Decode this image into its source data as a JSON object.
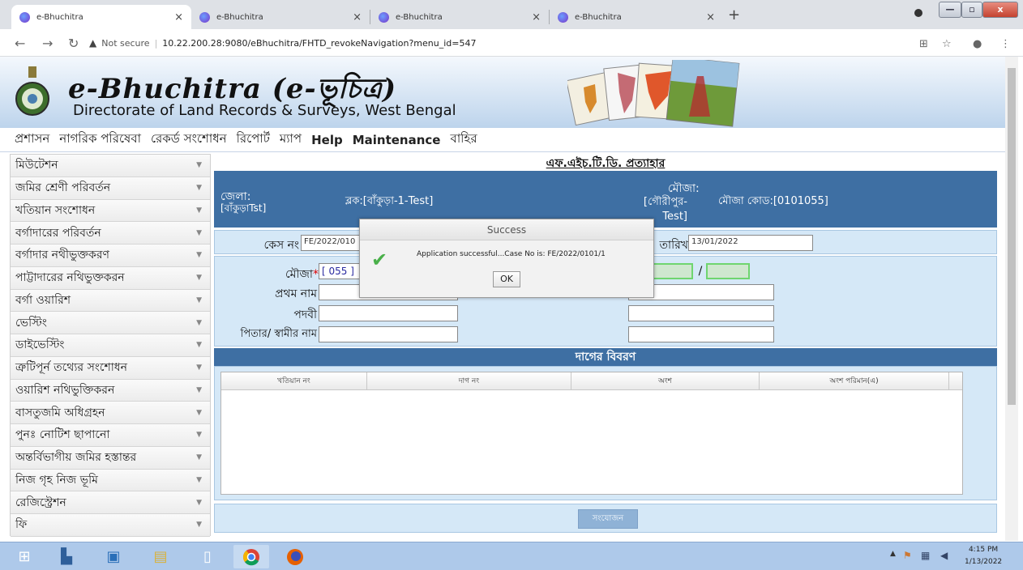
{
  "browser": {
    "tabs": [
      {
        "title": "e-Bhuchitra"
      },
      {
        "title": "e-Bhuchitra"
      },
      {
        "title": "e-Bhuchitra"
      },
      {
        "title": "e-Bhuchitra"
      }
    ],
    "security_label": "Not secure",
    "url": "10.22.200.28:9080/eBhuchitra/FHTD_revokeNavigation?menu_id=547"
  },
  "site": {
    "title": "e-Bhuchitra (e-ভূচিত্র)",
    "subtitle": "Directorate of Land Records & Surveys, West Bengal"
  },
  "menu": [
    "প্রশাসন",
    "নাগরিক পরিষেবা",
    "রেকর্ড সংশোধন",
    "রিপোর্ট",
    "ম্যাপ",
    "Help",
    "Maintenance",
    "বাহির"
  ],
  "sidebar": [
    "মিউটেশন",
    "জমির শ্রেণী পরিবর্তন",
    "খতিয়ান সংশোধন",
    "বর্গাদারের পরিবর্তন",
    "বর্গাদার নথীভুক্তকরণ",
    "পাট্টাদারের নথিভুক্তকরন",
    "বর্গা ওয়ারিশ",
    "ভেস্টিং",
    "ডাইভেস্টিং",
    "ত্রুটিপূর্ন তথ্যের সংশোধন",
    "ওয়ারিশ নথিভুক্তিকরন",
    "বাসতুজমি অধিগ্রহন",
    "পুনঃ নোটিশ ছাপানো",
    "অন্তর্বিভাগীয় জমির হস্তান্তর",
    "নিজ গৃহ নিজ ভূমি",
    "রেজিস্ট্রেশন",
    "ফি"
  ],
  "form": {
    "heading": "এফ.এইচ.টি.ডি. প্রত্যাহার",
    "district_label": "জেলা:",
    "district_value": "[বাঁকুড়াTst]",
    "block_label": "ব্লক:[বাঁকুড়া-1-Test]",
    "mouza_label": "মৌজা:",
    "mouza_value": "[গৌরীপুর-Test]",
    "mouza_code": "মৌজা কোড:[0101055]",
    "case_label": "কেস নং",
    "case_value": "FE/2022/010",
    "date_label": "তারিখ",
    "date_value": "13/01/2022",
    "mouza_field_label": "মৌজা",
    "mouza_field_value": "[ 055 ] ",
    "slash": "/",
    "first_name_label": "প্রথম নাম",
    "surname_label": "পদবী",
    "father_label": "পিতার/ স্বামীর নাম",
    "dag_heading": "দাগের বিবরণ",
    "table_headers": [
      "খতিয়ান নং",
      "দাগ নং",
      "অংশ",
      "অংশ পরিমান(এ)"
    ],
    "save_label": "সংযোজন"
  },
  "dialog": {
    "title": "Success",
    "message": "Application successful...Case No is: FE/2022/0101/1",
    "ok_label": "OK"
  },
  "clock": {
    "time": "4:15 PM",
    "date": "1/13/2022"
  }
}
